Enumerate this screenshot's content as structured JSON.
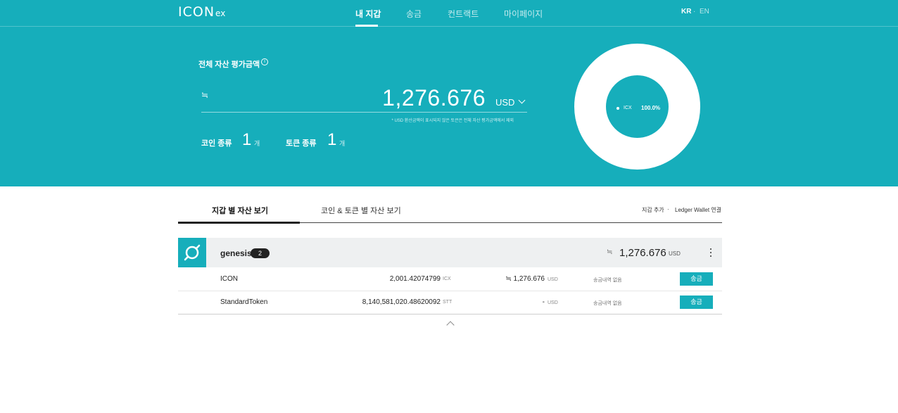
{
  "brand": {
    "logo_main": "ICON",
    "logo_suffix": "ex"
  },
  "nav": {
    "items": [
      {
        "label": "내 지갑",
        "active": true
      },
      {
        "label": "송금",
        "active": false
      },
      {
        "label": "컨트랙트",
        "active": false
      },
      {
        "label": "마이페이지",
        "active": false
      }
    ],
    "languages": [
      {
        "label": "KR",
        "active": true
      },
      {
        "label": "EN",
        "active": false
      }
    ]
  },
  "summary": {
    "title": "전체 자산 평가금액",
    "approx_symbol": "≒",
    "amount": "1,276.676",
    "currency": "USD",
    "note": "* USD 환산금액이 표시되지 않은 토큰은 전체 자산 평가금액에서 제외",
    "coin_label": "코인 종류",
    "coin_count": "1",
    "token_label": "토큰 종류",
    "token_count": "1",
    "count_unit": "개"
  },
  "donut": {
    "label": "ICX",
    "percent": "100.0%",
    "share": 1.0
  },
  "tabs": [
    {
      "label": "지갑 별 자산 보기",
      "active": true
    },
    {
      "label": "코인 & 토큰 별 자산 보기",
      "active": false
    }
  ],
  "actions": {
    "add_wallet": "지갑 추가",
    "ledger": "Ledger Wallet 연결"
  },
  "wallet": {
    "name": "genesis",
    "badge": "2",
    "approx_symbol": "≒",
    "total": "1,276.676",
    "unit": "USD",
    "rows": [
      {
        "name": "ICON",
        "balance": "2,001.42074799",
        "symbol": "ICX",
        "usd": "≒ 1,276.676",
        "usd_unit": "USD",
        "status": "송금내역 없음",
        "button": "송금"
      },
      {
        "name": "StandardToken",
        "balance": "8,140,581,020.48620092",
        "symbol": "STT",
        "usd": "-",
        "usd_unit": "USD",
        "status": "송금내역 없음",
        "button": "송금"
      }
    ]
  },
  "colors": {
    "primary": "#16aebb",
    "header_row": "#eef0f1",
    "dark": "#222222"
  }
}
